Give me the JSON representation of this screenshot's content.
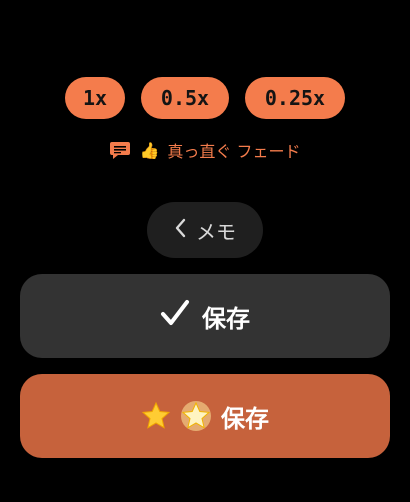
{
  "speeds": [
    "1x",
    "0.5x",
    "0.25x"
  ],
  "feedback": {
    "thumb_glyph": "👍",
    "text": "真っ直ぐ フェード",
    "icon": "comment-icon",
    "color": "#f47c4c"
  },
  "memo_button": {
    "label": "メモ",
    "icon": "chevron-left-icon"
  },
  "save_button": {
    "label": "保存",
    "icon": "checkmark-icon"
  },
  "save_star_button": {
    "label": "保存",
    "icons": [
      "star-icon",
      "glowing-star-icon"
    ]
  },
  "colors": {
    "accent": "#f47c4c",
    "save_star_bg": "#c6623c",
    "save_bg": "#333333",
    "memo_bg": "#1f1f1f"
  }
}
